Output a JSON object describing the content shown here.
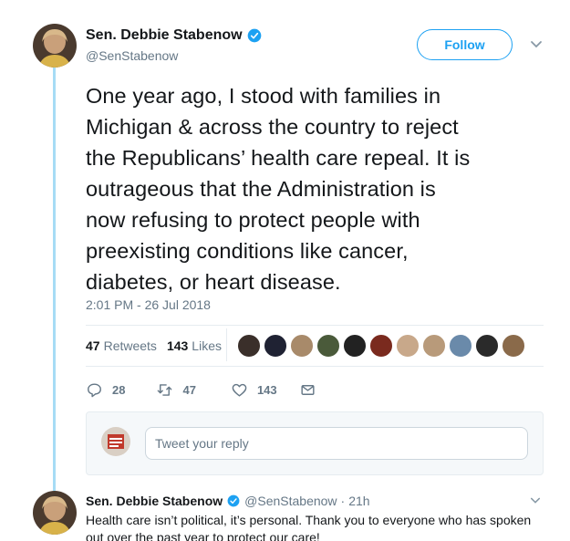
{
  "author": {
    "display_name": "Sen. Debbie Stabenow",
    "handle": "@SenStabenow",
    "verified_icon": "verified-badge-icon"
  },
  "follow_button": {
    "label": "Follow"
  },
  "tweet": {
    "lines": [
      "One year ago, I stood with families in",
      "Michigan & across the country to reject",
      "the Republicans’ health care repeal. It is",
      "outrageous that the Administration is",
      "now refusing to protect people with",
      "preexisting conditions like cancer,",
      "diabetes, or heart disease."
    ],
    "timestamp": "2:01 PM - 26 Jul 2018"
  },
  "stats": {
    "retweets_count": "47",
    "retweets_label": "Retweets",
    "likes_count": "143",
    "likes_label": "Likes",
    "liker_colors": [
      "#3a2f2a",
      "#1f2233",
      "#a88a6a",
      "#4a5a3a",
      "#222222",
      "#7a2a1e",
      "#c8a88a",
      "#b89a7a",
      "#6a8aaa",
      "#2a2a2a",
      "#8a6a4a"
    ]
  },
  "actions": {
    "reply_count": "28",
    "retweet_count": "47",
    "like_count": "143",
    "colors": {
      "icon": "#657786"
    }
  },
  "reply_box": {
    "placeholder": "Tweet your reply"
  },
  "reply_tweet": {
    "display_name": "Sen. Debbie Stabenow",
    "handle": "@SenStabenow",
    "separator": "·",
    "time": "21h",
    "lines": [
      "Health care isn’t political, it’s personal. Thank you to everyone who has spoken",
      "out over the past year to protect our care!"
    ]
  },
  "colors": {
    "accent": "#1da1f2",
    "thread_line": "#a6dcf5",
    "secondary_text": "#657786"
  }
}
